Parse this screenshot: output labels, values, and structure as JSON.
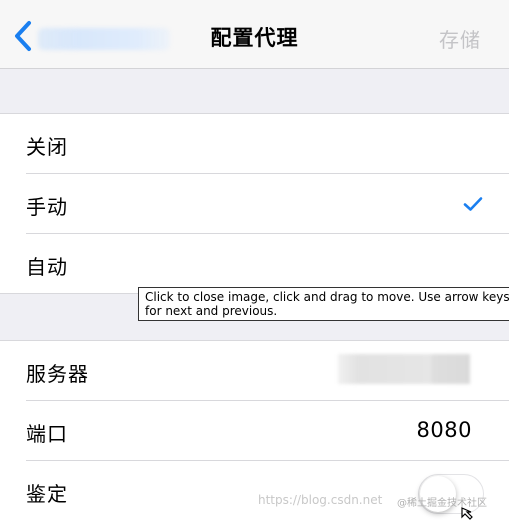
{
  "nav": {
    "title": "配置代理",
    "save_label": "存储",
    "accent_color": "#1a7ff0"
  },
  "proxy_modes": [
    {
      "label": "关闭",
      "selected": false
    },
    {
      "label": "手动",
      "selected": true
    },
    {
      "label": "自动",
      "selected": false
    }
  ],
  "settings": {
    "server_label": "服务器",
    "port_label": "端口",
    "port_value": "8080",
    "auth_label": "鉴定",
    "auth_enabled": false
  },
  "tooltip": {
    "text": "Click to close image, click and drag to move. Use arrow keys for next and previous."
  },
  "watermark": {
    "text": "https://blog.csdn.net",
    "text2": "@稀土掘金技术社区"
  }
}
